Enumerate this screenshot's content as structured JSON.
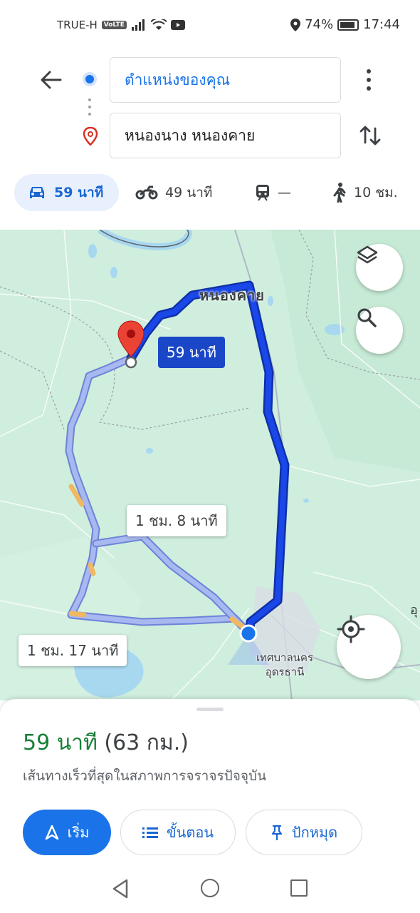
{
  "status_bar": {
    "carrier": "TRUE-H",
    "volte": "VoLTE",
    "battery": "74%",
    "time": "17:44"
  },
  "directions": {
    "origin": "ตำแหน่งของคุณ",
    "destination": "หนองนาง หนองคาย"
  },
  "modes": [
    {
      "name": "car",
      "label": "59 นาที",
      "icon": "car-icon",
      "selected": true
    },
    {
      "name": "motorcycle",
      "label": "49 นาที",
      "icon": "motorcycle-icon"
    },
    {
      "name": "transit",
      "label": "—",
      "icon": "transit-icon"
    },
    {
      "name": "walk",
      "label": "10 ชม.",
      "icon": "walk-icon"
    }
  ],
  "map": {
    "place_label": "หนองคาย",
    "city_label_line1": "เทศบาลนคร",
    "city_label_line2": "อุดรธานี",
    "edge_label": "อุ",
    "callouts": {
      "primary": "59 นาที",
      "alt1": "1 ชม. 8 นาที",
      "alt2": "1 ชม. 17 นาที"
    },
    "colors": {
      "route_primary": "#1a47e8",
      "route_alt": "#a8b8f0",
      "traffic": "#f0b860",
      "water": "#a8d8f0",
      "land": "#cfeedd"
    }
  },
  "sheet": {
    "time": "59 นาที",
    "distance": "(63 กม.)",
    "subtitle": "เส้นทางเร็วที่สุดในสภาพการจราจรปัจจุบัน",
    "buttons": {
      "start": "เริ่ม",
      "steps": "ขั้นตอน",
      "pin": "ปักหมุด"
    }
  }
}
